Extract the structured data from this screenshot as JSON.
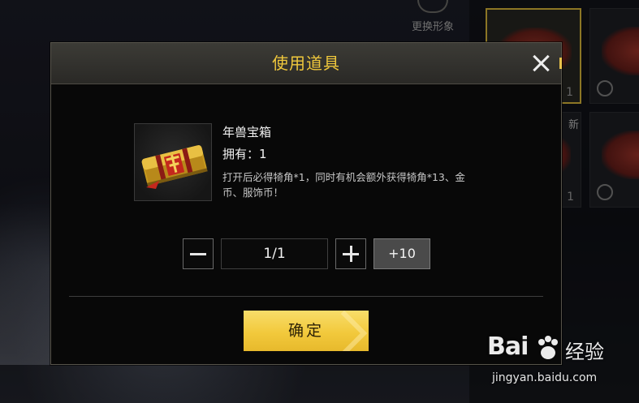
{
  "background": {
    "change_look_label": "更换形象",
    "new_badge": "新",
    "slot_counts": [
      "1",
      "1"
    ]
  },
  "dialog": {
    "title": "使用道具",
    "close_icon": "close-icon",
    "item": {
      "name": "年兽宝箱",
      "owned": "拥有：1",
      "description": "打开后必得犄角*1，同时有机会额外获得犄角*13、金币、服饰币！"
    },
    "quantity": {
      "value": "1/1",
      "plus_ten_label": "+10"
    },
    "confirm_label": "确定"
  },
  "watermark": {
    "logo_text": "Bai",
    "logo_cn": "经验",
    "url": "jingyan.baidu.com"
  },
  "colors": {
    "title_gold": "#f0c83c",
    "confirm_gold": "#f2c93c"
  }
}
